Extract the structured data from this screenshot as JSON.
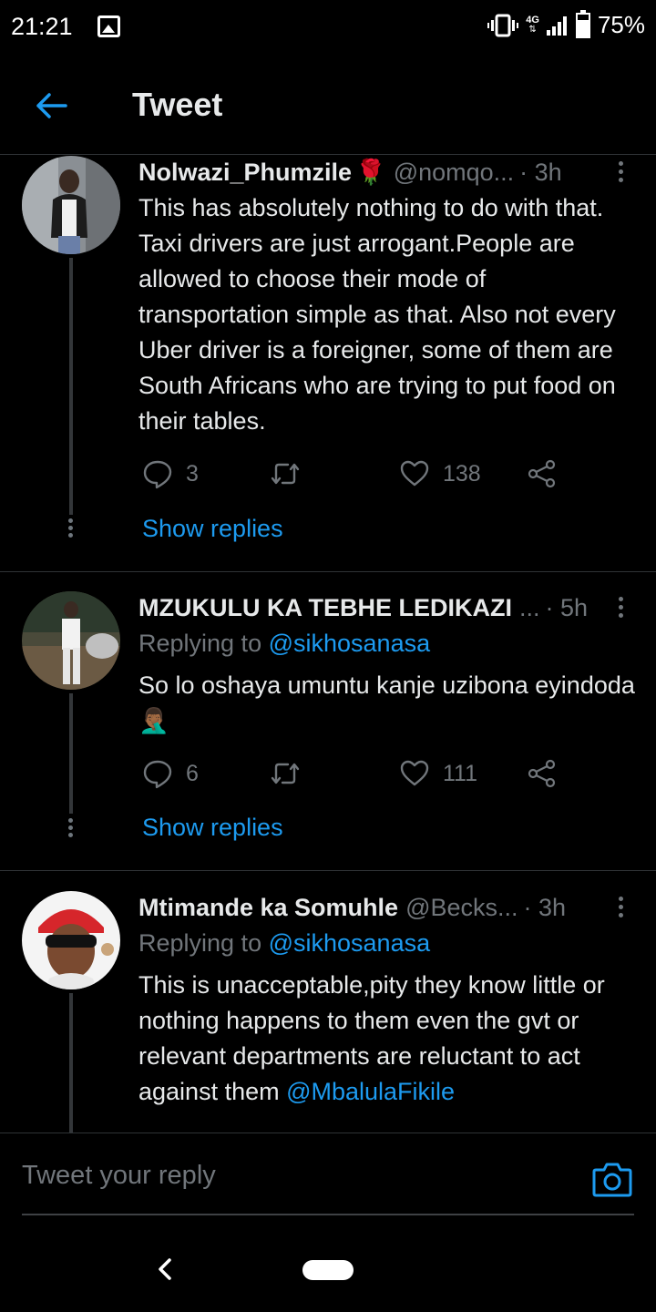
{
  "status": {
    "time": "21:21",
    "network": "4G",
    "battery": "75%",
    "battery_level": 0.75
  },
  "header": {
    "title": "Tweet"
  },
  "tweets": [
    {
      "author": "Nolwazi_Phumzile",
      "emoji": "🌹",
      "handle": "@nomqo...",
      "time": "· 3h",
      "replying_prefix": "",
      "replying_to": "",
      "text_parts": [
        {
          "text": "This has absolutely nothing to do with that. Taxi drivers are just arrogant.People are allowed to choose their mode of transportation simple as that. Also not every Uber driver is a foreigner, some of them are South Africans who are trying to put food on their tables.",
          "mention": false
        }
      ],
      "replies": "3",
      "retweets": "",
      "likes": "138",
      "show_replies": "Show replies"
    },
    {
      "author": "MZUKULU KA TEBHE LEDIKAZI",
      "emoji": "",
      "handle": "...",
      "time": "· 5h",
      "replying_prefix": "Replying to ",
      "replying_to": "@sikhosanasa",
      "text_parts": [
        {
          "text": "So lo oshaya umuntu kanje uzibona eyindoda 🤦🏾‍♂️",
          "mention": false
        }
      ],
      "replies": "6",
      "retweets": "",
      "likes": "111",
      "show_replies": "Show replies"
    },
    {
      "author": "Mtimande ka Somuhle",
      "emoji": "",
      "handle": "@Becks...",
      "time": "· 3h",
      "replying_prefix": "Replying to ",
      "replying_to": "@sikhosanasa",
      "text_parts": [
        {
          "text": "This is unacceptable,pity they know little or nothing happens to them even the gvt or relevant departments are reluctant to act against them ",
          "mention": false
        },
        {
          "text": "@MbalulaFikile",
          "mention": true
        }
      ]
    }
  ],
  "reply_bar": {
    "placeholder": "Tweet your reply"
  },
  "icons": {
    "back": "arrow-left-icon",
    "reply": "comment-icon",
    "retweet": "retweet-icon",
    "like": "heart-icon",
    "share": "share-icon",
    "camera": "camera-icon"
  },
  "colors": {
    "accent": "#1d9bf0",
    "background": "#000000",
    "text": "#e7e9ea",
    "muted": "#71767b"
  }
}
